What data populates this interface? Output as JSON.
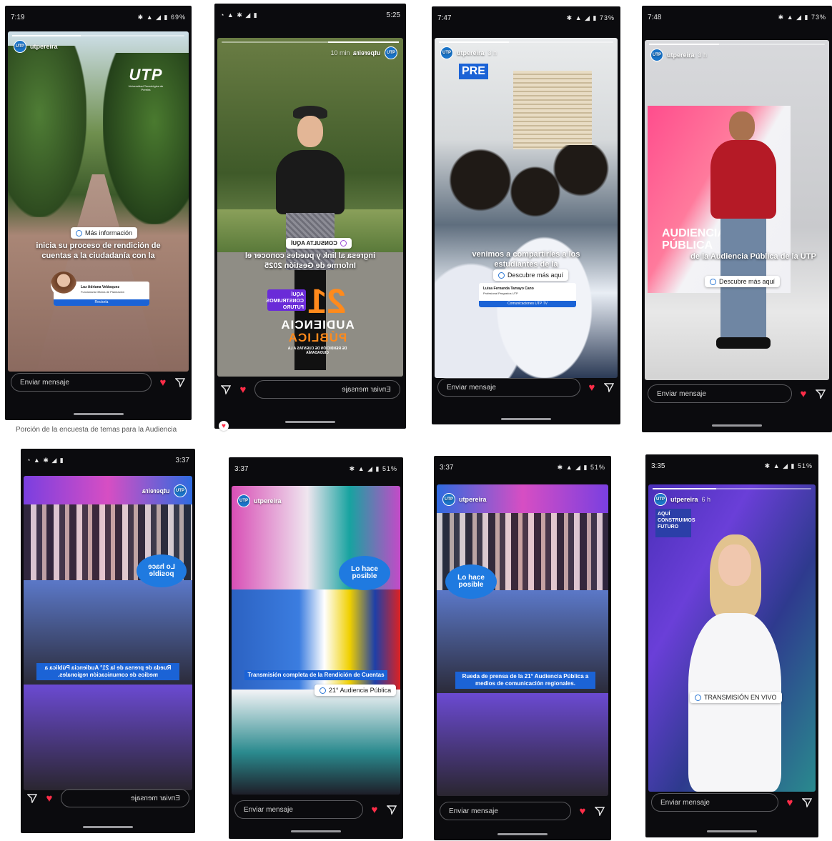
{
  "shared": {
    "account": "utpereira",
    "send_placeholder": "Enviar mensaje"
  },
  "caption_below": "Porción de la encuesta de temas para la Audiencia",
  "stories": [
    {
      "time": "7:19",
      "battery": "69%",
      "ago": "",
      "logo": "UTP",
      "logo_sub": "Universidad Tecnológica de Pereira",
      "sticker": "Más información",
      "caption": "inicia su proceso de rendición de cuentas a la ciudadanía con la",
      "card_name": "Luz Adriana Velásquez",
      "card_role": "Funcionaria Oficina de Planeación",
      "card_button": "Rectoría"
    },
    {
      "time": "5:25",
      "ago": "10 min",
      "sticker": "CONSULTA AQUÍ",
      "caption": "ingresa al link y puedes conocer el Informe de Gestión 2025",
      "badge": "AQUÍ CONSTRUIMOS FUTURO",
      "big_number": "21",
      "title1": "AUDIENCIA",
      "title2": "PÚBLICA",
      "subtitle": "DE RENDICIÓN DE CUENTAS A LA CIUDADANÍA"
    },
    {
      "time": "7:47",
      "battery": "73%",
      "ago": "3 h",
      "top_tag": "PRE",
      "caption": "venimos a compartirles a los estudiantes de la",
      "sticker": "Descubre más aquí",
      "card_name": "Luisa Fernanda Tamayo Cano",
      "card_role": "Profesional Pregrados UTP",
      "card_button": "Comunicaciones UTP TV"
    },
    {
      "time": "7:48",
      "battery": "73%",
      "ago": "3 h",
      "screen_title": "AUDIENCIA PÚBLICA",
      "caption": "de la Audiencia Pública de la UTP",
      "sticker": "Descubre más aquí"
    },
    {
      "time": "3:37",
      "ago": "",
      "bubble": "Lo hace posible",
      "caption": "Rueda de prensa de la 21° Audiencia Pública a medios de comunicación regionales."
    },
    {
      "time": "3:37",
      "battery": "51%",
      "ago": "",
      "bubble": "Lo hace posible",
      "caption": "Transmisión completa de la Rendición de Cuentas",
      "sticker": "21° Audiencia Pública"
    },
    {
      "time": "3:37",
      "battery": "51%",
      "ago": "",
      "bubble": "Lo hace posible",
      "caption": "Rueda de prensa de la 21° Audiencia Pública a medios de comunicación regionales."
    },
    {
      "time": "3:35",
      "battery": "51%",
      "ago": "6 h",
      "badge": "AQUÍ CONSTRUIMOS FUTURO",
      "sticker": "TRANSMISIÓN EN VIVO"
    }
  ],
  "colors": {
    "heart": "#ff2d48",
    "utp_blue": "#1b63d6",
    "purple": "#6a2bd8",
    "orange": "#ff8a1c"
  }
}
